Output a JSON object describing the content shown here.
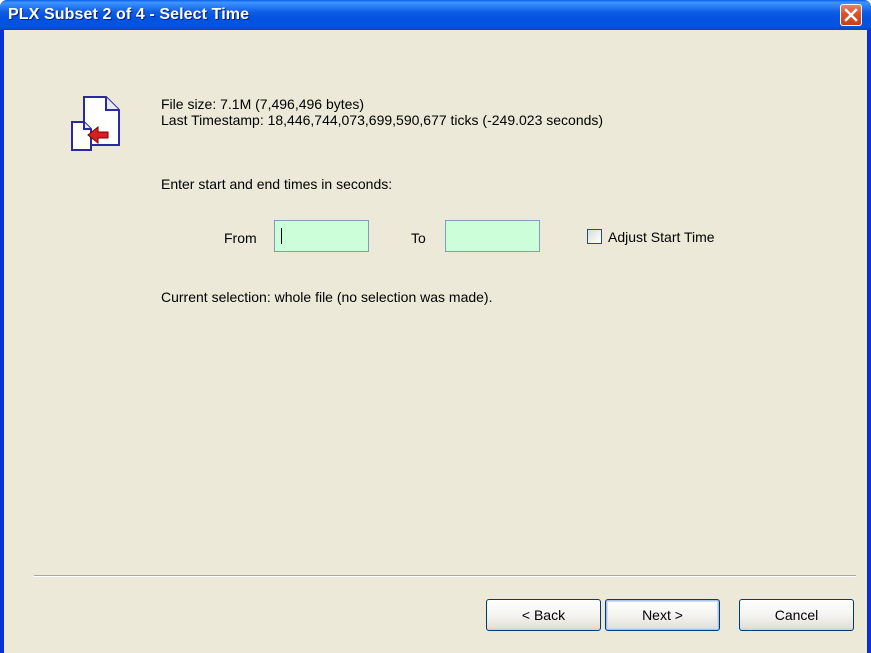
{
  "window": {
    "title": "PLX Subset 2 of 4 - Select Time"
  },
  "info": {
    "file_size": "File size: 7.1M (7,496,496 bytes)",
    "last_timestamp": "Last Timestamp: 18,446,744,073,699,590,677 ticks (-249.023 seconds)"
  },
  "prompt": "Enter start and end times in seconds:",
  "from": {
    "label": "From",
    "value": ""
  },
  "to": {
    "label": "To",
    "value": ""
  },
  "adjust_start_time": {
    "label": "Adjust Start Time",
    "checked": false
  },
  "selection_status": "Current selection: whole file (no selection was made).",
  "buttons": {
    "back": "< Back",
    "next": "Next >",
    "cancel": "Cancel"
  },
  "colors": {
    "field_background": "#ccffd9",
    "dialog_background": "#ece9d8",
    "titlebar": "#0352e0",
    "close_button": "#d9542b"
  },
  "icons": {
    "app": "file-import-icon",
    "close": "close-icon"
  }
}
